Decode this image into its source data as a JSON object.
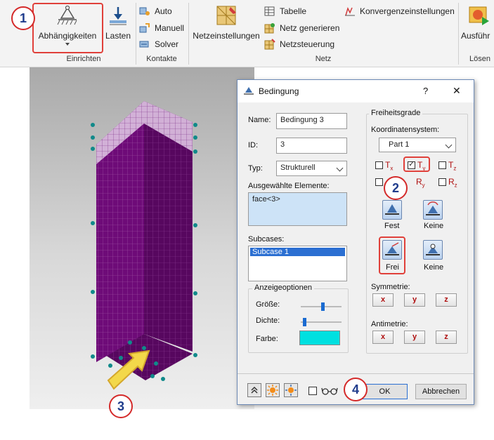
{
  "ribbon": {
    "einrichten": {
      "abhaengigkeiten": "Abhängigkeiten",
      "lasten": "Lasten",
      "group_label": "Einrichten"
    },
    "kontakte": {
      "auto": "Auto",
      "manuell": "Manuell",
      "solver": "Solver",
      "group_label": "Kontakte"
    },
    "netz": {
      "netzeinstellungen": "Netzeinstellungen",
      "tabelle": "Tabelle",
      "netz_generieren": "Netz generieren",
      "netzsteuerung": "Netzsteuerung",
      "konvergenz": "Konvergenzeinstellungen",
      "group_label": "Netz"
    },
    "loesen": {
      "ausfuehren": "Ausführ",
      "group_label": "Lösen"
    }
  },
  "dialog": {
    "title": "Bedingung",
    "help": "?",
    "close": "✕",
    "name_label": "Name:",
    "name_value": "Bedingung 3",
    "id_label": "ID:",
    "id_value": "3",
    "typ_label": "Typ:",
    "typ_value": "Strukturell",
    "selected_label": "Ausgewählte Elemente:",
    "selected_value": "face<3>",
    "subcases_label": "Subcases:",
    "subcase_item": "Subcase 1",
    "display_options": {
      "legend": "Anzeigeoptionen",
      "groesse": "Größe:",
      "dichte": "Dichte:",
      "farbe": "Farbe:",
      "groesse_level": 0.55,
      "dichte_level": 0.05,
      "color": "#00e0e0"
    },
    "dof": {
      "legend": "Freiheitsgrade",
      "coord_label": "Koordinatensystem:",
      "coord_value": "Part 1",
      "tx": "T",
      "tx_sub": "x",
      "ty": "T",
      "ty_sub": "y",
      "tz": "T",
      "tz_sub": "z",
      "rx": "R",
      "rx_sub": "x",
      "ry": "R",
      "ry_sub": "y",
      "rz": "R",
      "rz_sub": "z",
      "ty_checked": true,
      "fest": "Fest",
      "keine1": "Keine",
      "frei": "Frei",
      "keine2": "Keine",
      "symmetrie": "Symmetrie:",
      "antimetrie": "Antimetrie:",
      "x": "x",
      "y": "y",
      "z": "z"
    },
    "ok": "OK",
    "abbrechen": "Abbrechen"
  },
  "callouts": {
    "c1": "1",
    "c2": "2",
    "c3": "3",
    "c4": "4"
  },
  "colors": {
    "mesh": "#6e0b78",
    "mesh_light": "#d3b1d6",
    "constraint": "#108a8a",
    "callout_border": "#d42a2a",
    "callout_text": "#1f3c8c"
  }
}
